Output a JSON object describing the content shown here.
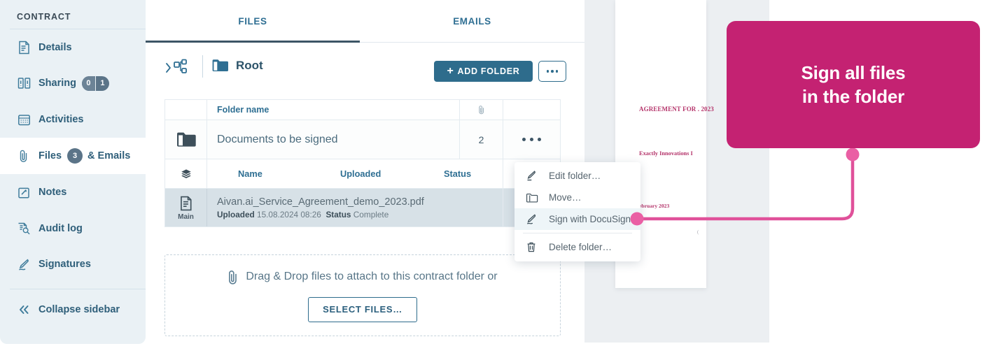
{
  "sidebar": {
    "title": "CONTRACT",
    "items": [
      {
        "label": "Details",
        "icon": "document-icon"
      },
      {
        "label": "Sharing",
        "icon": "sharing-icon",
        "badge_left": "0",
        "badge_right": "1"
      },
      {
        "label": "Activities",
        "icon": "calendar-icon"
      },
      {
        "label_before": "Files",
        "label_after": "& Emails",
        "icon": "paperclip-icon",
        "badge": "3",
        "active": true
      },
      {
        "label": "Notes",
        "icon": "notes-icon"
      },
      {
        "label": "Audit log",
        "icon": "audit-icon"
      },
      {
        "label": "Signatures",
        "icon": "signature-icon"
      }
    ],
    "collapse": {
      "label": "Collapse sidebar",
      "icon": "chevron-double-left-icon"
    }
  },
  "tabs": [
    {
      "label": "FILES",
      "active": true
    },
    {
      "label": "EMAILS",
      "active": false
    }
  ],
  "toolbar": {
    "tree_icon": "folder-tree-icon",
    "root_label": "Root",
    "add_folder_label": "ADD FOLDER",
    "add_folder_plus": "+",
    "more_icon": "ellipsis-icon"
  },
  "folder_table": {
    "header": {
      "name": "Folder name",
      "attachments_icon": "paperclip-icon"
    },
    "row": {
      "name": "Documents to be signed",
      "count": "2",
      "icon": "folder-icon",
      "actions_icon": "ellipsis-icon"
    }
  },
  "file_table": {
    "header": {
      "layer_icon": "layers-icon",
      "name": "Name",
      "uploaded": "Uploaded",
      "status": "Status"
    },
    "rows": [
      {
        "icon": "file-document-icon",
        "badge": "Main",
        "filename": "Aivan.ai_Service_Agreement_demo_2023.pdf",
        "uploaded_label": "Uploaded",
        "uploaded_value": "15.08.2024 08:26",
        "status_label": "Status",
        "status_value": "Complete"
      }
    ]
  },
  "dropzone": {
    "icon": "paperclip-icon",
    "text": "Drag & Drop files to attach to this contract folder or",
    "button_label": "SELECT FILES…"
  },
  "context_menu": {
    "items": [
      {
        "label": "Edit folder…",
        "icon": "pencil-icon",
        "highlighted": false
      },
      {
        "label": "Move…",
        "icon": "folder-icon",
        "highlighted": false
      },
      {
        "label": "Sign with DocuSign…",
        "icon": "signature-icon",
        "highlighted": true
      },
      {
        "label": "Delete folder…",
        "icon": "trash-icon",
        "highlighted": false
      }
    ]
  },
  "callout": {
    "text": "Sign all files\nin the folder",
    "color": "#c42272"
  },
  "document_preview": {
    "line1": "AGREEMENT FOR .\n2023",
    "line2": "Exactly Innovations I",
    "line3": "ebruary 2023",
    "line4": "("
  },
  "colors": {
    "accent_blue": "#2e6c8c",
    "sidebar_bg": "#eaf1f5",
    "pink": "#c42272",
    "connector_pink": "#e0519a",
    "selected_row": "#d7e1e7"
  }
}
